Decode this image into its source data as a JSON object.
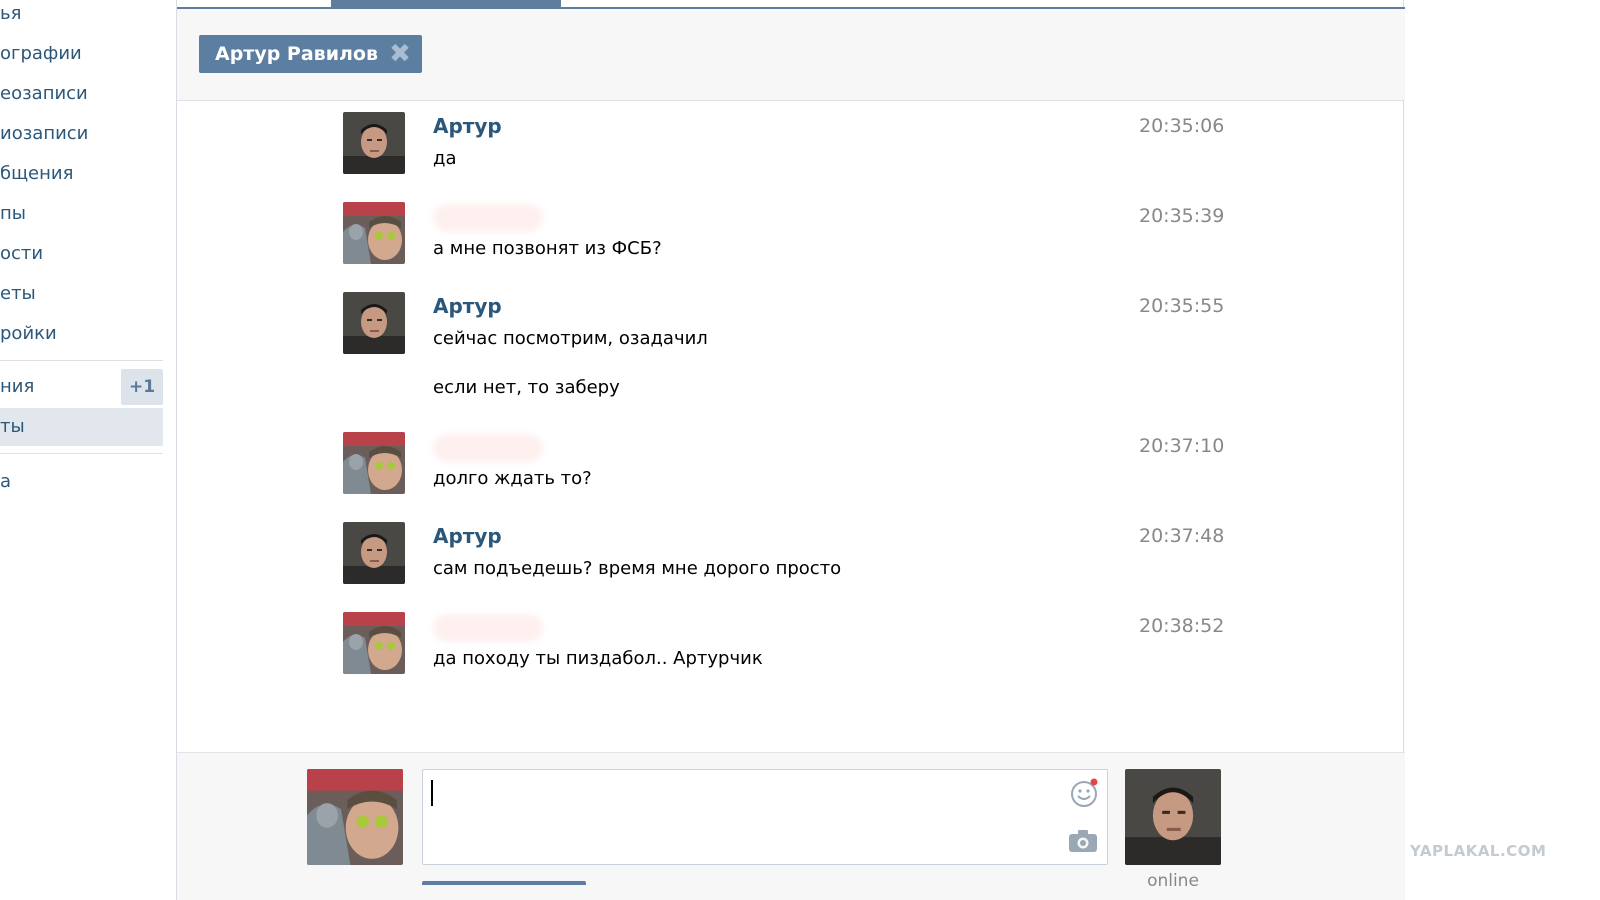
{
  "sidebar": {
    "items": [
      {
        "label": "ья"
      },
      {
        "label": "ографии"
      },
      {
        "label": "еозаписи"
      },
      {
        "label": "иозаписи"
      },
      {
        "label": "бщения"
      },
      {
        "label": "пы"
      },
      {
        "label": "ости"
      },
      {
        "label": "еты"
      },
      {
        "label": "ройки"
      },
      {
        "label": "ния",
        "badge": "+1"
      },
      {
        "label": "ты"
      },
      {
        "label": "а"
      }
    ]
  },
  "header": {
    "recipient_chip": "Артур Равилов",
    "close_glyph": "✖"
  },
  "messages": [
    {
      "author": "Артур",
      "time": "20:35:06",
      "lines": [
        "да"
      ]
    },
    {
      "author": "",
      "time": "20:35:39",
      "lines": [
        "а мне позвонят из ФСБ?"
      ]
    },
    {
      "author": "Артур",
      "time": "20:35:55",
      "lines": [
        "сейчас посмотрим, озадачил",
        "если нет, то заберу"
      ]
    },
    {
      "author": "",
      "time": "20:37:10",
      "lines": [
        "долго ждать то?"
      ]
    },
    {
      "author": "Артур",
      "time": "20:37:48",
      "lines": [
        "сам подъедешь? время мне дорого просто"
      ]
    },
    {
      "author": "",
      "time": "20:38:52",
      "lines": [
        "да походу ты пиздабол.. Артурчик"
      ]
    }
  ],
  "composer": {
    "value": "",
    "online_label": "online"
  },
  "icons": {
    "smile": "smile-icon",
    "camera": "camera-icon",
    "notification_dot_color": "#e64646"
  },
  "colors": {
    "accent": "#5b7ea1",
    "link": "#2b587a",
    "time": "#888888"
  },
  "watermark": "YAPLAKAL.COM"
}
